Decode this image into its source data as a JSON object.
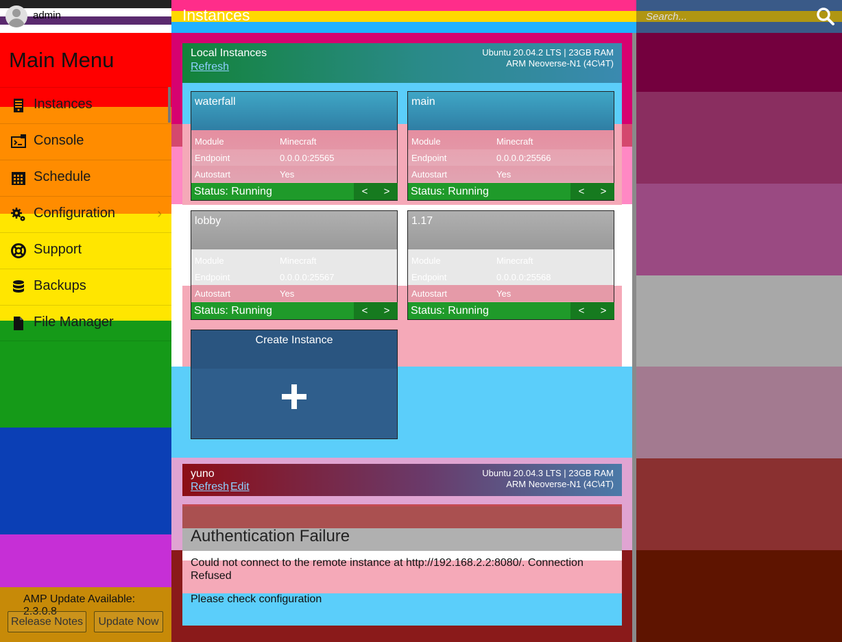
{
  "user": {
    "name": "admin"
  },
  "sidebar": {
    "title": "Main Menu",
    "items": [
      {
        "label": "Instances",
        "icon": "server-icon"
      },
      {
        "label": "Console",
        "icon": "console-icon"
      },
      {
        "label": "Schedule",
        "icon": "calendar-icon"
      },
      {
        "label": "Configuration",
        "icon": "gears-icon"
      },
      {
        "label": "Support",
        "icon": "lifebuoy-icon"
      },
      {
        "label": "Backups",
        "icon": "database-icon"
      },
      {
        "label": "File Manager",
        "icon": "file-icon"
      }
    ],
    "update_text": "AMP Update Available: 2.3.0.8",
    "release_notes_label": "Release Notes",
    "update_now_label": "Update Now"
  },
  "header": {
    "title": "Instances",
    "search_placeholder": "Search..."
  },
  "local": {
    "title": "Local Instances",
    "refresh_label": "Refresh",
    "info_line1": "Ubuntu 20.04.2 LTS | 23GB RAM",
    "info_line2": "ARM Neoverse-N1 (4C\\4T)",
    "labels": {
      "module": "Module",
      "endpoint": "Endpoint",
      "autostart": "Autostart"
    },
    "instances": [
      {
        "name": "waterfall",
        "module": "Minecraft",
        "endpoint": "0.0.0.0:25565",
        "autostart": "Yes",
        "status": "Status: Running"
      },
      {
        "name": "main",
        "module": "Minecraft",
        "endpoint": "0.0.0.0:25566",
        "autostart": "Yes",
        "status": "Status: Running"
      },
      {
        "name": "lobby",
        "module": "Minecraft",
        "endpoint": "0.0.0.0:25567",
        "autostart": "Yes",
        "status": "Status: Running"
      },
      {
        "name": "1.17",
        "module": "Minecraft",
        "endpoint": "0.0.0.0:25568",
        "autostart": "Yes",
        "status": "Status: Running"
      }
    ],
    "nav_prev": "<",
    "nav_next": ">",
    "create_label": "Create Instance"
  },
  "remote": {
    "title": "yuno",
    "refresh_label": "Refresh",
    "edit_label": "Edit",
    "info_line1": "Ubuntu 20.04.3 LTS | 23GB RAM",
    "info_line2": "ARM Neoverse-N1 (4C\\4T)",
    "error_title": "Authentication Failure",
    "error_message": "Could not connect to the remote instance at http://192.168.2.2:8080/. Connection Refused",
    "error_hint": "Please check configuration"
  }
}
